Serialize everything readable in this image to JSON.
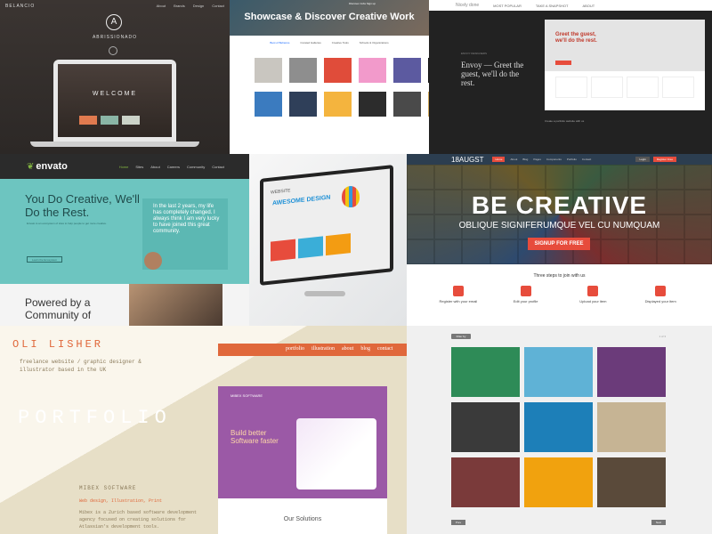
{
  "tile1": {
    "brand": "BELANCIO",
    "nav": [
      "About",
      "Brands",
      "Design",
      "Contact"
    ],
    "logo_letter": "A",
    "title": "ABRISSIONADO",
    "screen_text": "WELCOME",
    "box_colors": [
      "#e07a4f",
      "#8ab5a5",
      "#cbd3c8"
    ]
  },
  "tile2": {
    "top_nav": "Discover   Jobs   Sign up",
    "headline": "Showcase & Discover Creative Work",
    "tabs": [
      "Best of Behance",
      "Curated Galleries",
      "Creative Tools",
      "Schools & Organizations"
    ],
    "thumb_colors": [
      "#c9c6c0",
      "#8e8e8e",
      "#e04c3a",
      "#f29acb",
      "#5c5aa0",
      "#141414",
      "#3b7bbf",
      "#2f3f59",
      "#f4b43e",
      "#2c2c2c",
      "#4a4a4a",
      "#d1a85a"
    ]
  },
  "tile3": {
    "brand": "Nicely done",
    "nav": [
      "MOST POPULAR",
      "TAKE A SNAPSHOT",
      "ABOUT"
    ],
    "small": "ENVOY DESIGNERS",
    "heading": "Envoy — Greet the guest, we'll do the rest.",
    "shot_heading": "Greet the guest, we'll do the rest.",
    "footer": "Create a portfolio website with us"
  },
  "tile4": {
    "logo": "envato",
    "nav": [
      "Home",
      "Sites",
      "About",
      "Careers",
      "Community",
      "Contact"
    ],
    "headline": "You Do Creative, We'll Do the Rest.",
    "paragraph": "Envato is an ecosystem of sites to help people to get more creative.",
    "button": "Learn the Ecosystem",
    "quote": "In the last 2 years, my life has completely changed. I always think I am very lucky to have joined this great community.",
    "lower_heading": "Powered by a Community of"
  },
  "tile5": {
    "site": "WEBSITE",
    "headline": "AWESOME DESIGN",
    "block_colors": [
      "#e74c3c",
      "#3aaed8",
      "#f39c12"
    ]
  },
  "tile6": {
    "brand": "18AUGST",
    "nav": [
      "Home",
      "About",
      "Blog",
      "Pages",
      "Components",
      "Portfolio",
      "Contact"
    ],
    "login": "Login",
    "register": "Register Free",
    "headline": "BE CREATIVE",
    "subtitle": "OBLIQUE SIGNIFERUMQUE VEL CU NUMQUAM",
    "cta": "SIGNUP FOR FREE",
    "steps_title": "Three steps to join with us",
    "steps": [
      "Register with your email",
      "Edit your profile",
      "Upload your item",
      "Displayed your item"
    ]
  },
  "tile7": {
    "name": "OLI LISHER",
    "bio": "freelance website / graphic designer & illustrator based in the UK",
    "portfolio": "PORTFOLIO",
    "nav": [
      "portfolio",
      "illustration",
      "about",
      "blog",
      "contact"
    ],
    "project": "MIBEX SOFTWARE",
    "tags": "Web design, Illustration, Print",
    "desc": "Mibex is a Zurich based software development agency focused on creating solutions for Atlassian's development tools.",
    "shot_brand": "MIBEX SOFTWARE",
    "shot_heading": "Build better Software faster",
    "solutions": "Our Solutions"
  },
  "tile8": {
    "filter": "Filter by",
    "pager": "1 of 3",
    "prev": "Prev",
    "next": "Next",
    "thumb_colors": [
      "#2e8b57",
      "#5fb2d6",
      "#6b3b7a",
      "#3a3a3a",
      "#1d7fb8",
      "#c6b494",
      "#7a3a3a",
      "#f1a20e",
      "#5a4a3a"
    ]
  }
}
